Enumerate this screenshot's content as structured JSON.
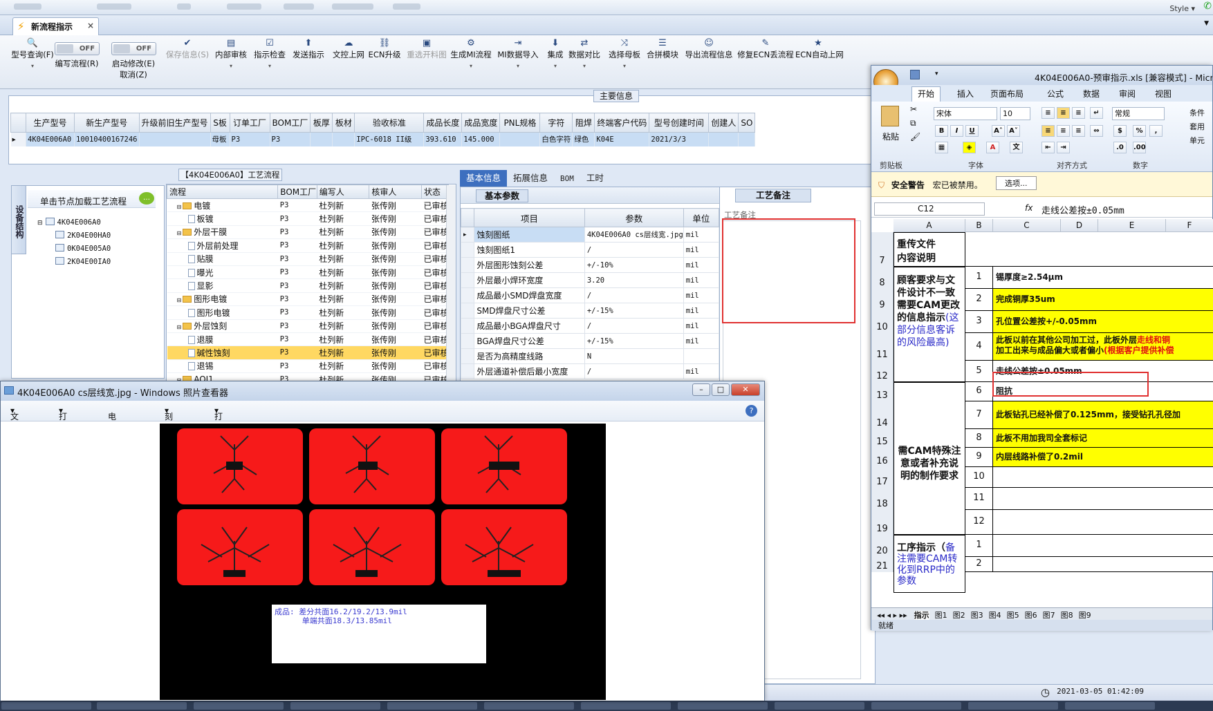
{
  "app": {
    "style_label": "Style ▾",
    "doc_tab": "新流程指示"
  },
  "toolbar": {
    "items": [
      {
        "label": "型号查询(F)",
        "icon": "search-icon",
        "disabled": false
      },
      {
        "label": "编写流程(R)",
        "icon": "toggle",
        "toggle": "OFF",
        "disabled": false
      },
      {
        "label": "启动修改(E)",
        "icon": "toggle",
        "toggle": "OFF",
        "disabled": false,
        "sub": "取消(Z)"
      },
      {
        "label": "保存信息(S)",
        "icon": "check-icon",
        "disabled": true
      },
      {
        "label": "内部审核",
        "icon": "audit-icon",
        "disabled": false
      },
      {
        "label": "指示检查",
        "icon": "checklist-icon",
        "disabled": false
      },
      {
        "label": "发送指示",
        "icon": "upload-icon",
        "disabled": false
      },
      {
        "label": "文控上网",
        "icon": "cloud-upload-icon",
        "disabled": false
      },
      {
        "label": "ECN升级",
        "icon": "binoculars-icon",
        "disabled": false
      },
      {
        "label": "重选开料图",
        "icon": "image-icon",
        "disabled": true
      },
      {
        "label": "生成MI流程",
        "icon": "gears-icon",
        "disabled": false
      },
      {
        "label": "MI数据导入",
        "icon": "import-icon",
        "disabled": false
      },
      {
        "label": "集成",
        "icon": "download-icon",
        "disabled": false
      },
      {
        "label": "数据对比",
        "icon": "compare-icon",
        "disabled": false
      },
      {
        "label": "选择母板",
        "icon": "shuffle-icon",
        "disabled": false
      },
      {
        "label": "合拼模块",
        "icon": "list-icon",
        "disabled": false
      },
      {
        "label": "导出流程信息",
        "icon": "smile-icon",
        "disabled": false
      },
      {
        "label": "修复ECN丢流程",
        "icon": "wrench-icon",
        "disabled": false
      },
      {
        "label": "ECN自动上网",
        "icon": "star-icon",
        "disabled": false
      }
    ]
  },
  "main_info": {
    "section_label": "主要信息",
    "headers": [
      "生产型号",
      "新生产型号",
      "升级前旧生产型号",
      "S板",
      "订单工厂",
      "BOM工厂",
      "板厚",
      "板材",
      "验收标准",
      "成品长度",
      "成品宽度",
      "PNL规格",
      "字符",
      "阻焊",
      "终端客户代码",
      "型号创建时间",
      "创建人",
      "SO"
    ],
    "row": [
      "4K04E006A0",
      "10010400167246",
      "",
      "母板",
      "P3",
      "P3",
      "",
      "",
      "IPC-6018 II级",
      "393.610",
      "145.000",
      "",
      "白色字符",
      "绿色",
      "K04E",
      "2021/3/3",
      "",
      ""
    ]
  },
  "left_panel": {
    "vertical_tab": "设备结构",
    "load_title": "单击节点加载工艺流程",
    "tree": [
      "4K04E006A0",
      "2K04E00HA0",
      "0K04E005A0",
      "2K04E00IA0"
    ]
  },
  "flow": {
    "label": "【4K04E006A0】工艺流程",
    "headers": [
      "流程",
      "BOM工厂",
      "编写人",
      "核审人",
      "状态"
    ],
    "rows": [
      {
        "name": "电镀",
        "level": 0,
        "folder": true,
        "bom": "P3",
        "writer": "杜列新",
        "reviewer": "张传刚",
        "status": "已审核"
      },
      {
        "name": "板镀",
        "level": 1,
        "folder": false,
        "bom": "P3",
        "writer": "杜列新",
        "reviewer": "张传刚",
        "status": "已审核"
      },
      {
        "name": "外层干膜",
        "level": 0,
        "folder": true,
        "bom": "P3",
        "writer": "杜列新",
        "reviewer": "张传刚",
        "status": "已审核"
      },
      {
        "name": "外层前处理",
        "level": 1,
        "folder": false,
        "bom": "P3",
        "writer": "杜列新",
        "reviewer": "张传刚",
        "status": "已审核"
      },
      {
        "name": "贴膜",
        "level": 1,
        "folder": false,
        "bom": "P3",
        "writer": "杜列新",
        "reviewer": "张传刚",
        "status": "已审核"
      },
      {
        "name": "曝光",
        "level": 1,
        "folder": false,
        "bom": "P3",
        "writer": "杜列新",
        "reviewer": "张传刚",
        "status": "已审核"
      },
      {
        "name": "显影",
        "level": 1,
        "folder": false,
        "bom": "P3",
        "writer": "杜列新",
        "reviewer": "张传刚",
        "status": "已审核"
      },
      {
        "name": "图形电镀",
        "level": 0,
        "folder": true,
        "bom": "P3",
        "writer": "杜列新",
        "reviewer": "张传刚",
        "status": "已审核"
      },
      {
        "name": "图形电镀",
        "level": 1,
        "folder": false,
        "bom": "P3",
        "writer": "杜列新",
        "reviewer": "张传刚",
        "status": "已审核"
      },
      {
        "name": "外层蚀刻",
        "level": 0,
        "folder": true,
        "bom": "P3",
        "writer": "杜列新",
        "reviewer": "张传刚",
        "status": "已审核"
      },
      {
        "name": "退膜",
        "level": 1,
        "folder": false,
        "bom": "P3",
        "writer": "杜列新",
        "reviewer": "张传刚",
        "status": "已审核"
      },
      {
        "name": "碱性蚀刻",
        "level": 1,
        "folder": false,
        "bom": "P3",
        "writer": "杜列新",
        "reviewer": "张传刚",
        "status": "已审核",
        "selected": true
      },
      {
        "name": "退锡",
        "level": 1,
        "folder": false,
        "bom": "P3",
        "writer": "杜列新",
        "reviewer": "张传刚",
        "status": "已审核"
      },
      {
        "name": "AOI1",
        "level": 0,
        "folder": true,
        "bom": "P3",
        "writer": "杜列新",
        "reviewer": "张传刚",
        "status": "已审核"
      }
    ]
  },
  "info_tabs": [
    "基本信息",
    "拓展信息",
    "BOM",
    "工时"
  ],
  "params": {
    "section": "基本参数",
    "headers": [
      "项目",
      "参数",
      "单位"
    ],
    "rows": [
      {
        "name": "蚀刻图纸",
        "value": "4K04E006A0 cs层线宽.jpg",
        "unit": "mil",
        "selected": true
      },
      {
        "name": "蚀刻图纸1",
        "value": "/",
        "unit": "mil"
      },
      {
        "name": "外层图形蚀刻公差",
        "value": "+/-10%",
        "unit": "mil"
      },
      {
        "name": "外层最小焊环宽度",
        "value": "3.20",
        "unit": "mil"
      },
      {
        "name": "成品最小SMD焊盘宽度",
        "value": "/",
        "unit": "mil"
      },
      {
        "name": "SMD焊盘尺寸公差",
        "value": "+/-15%",
        "unit": "mil"
      },
      {
        "name": "成品最小BGA焊盘尺寸",
        "value": "/",
        "unit": "mil"
      },
      {
        "name": "BGA焊盘尺寸公差",
        "value": "+/-15%",
        "unit": "mil"
      },
      {
        "name": "是否为高精度线路",
        "value": "N",
        "unit": ""
      },
      {
        "name": "外层通道补偿后最小宽度",
        "value": "/",
        "unit": "mil"
      }
    ]
  },
  "notes": {
    "header": "工艺备注",
    "sub": "工艺备注"
  },
  "status": {
    "clock": "2021-03-05 01:42:09"
  },
  "photo_viewer": {
    "title": "4K04E006A0 cs层线宽.jpg - Windows 照片查看器",
    "menus": [
      "文件(F)",
      "打印(P)",
      "电子邮件(E)",
      "刻录(U)",
      "打开(O)"
    ],
    "caption_line1": "成品: 差分共面16.2/19.2/13.9mil",
    "caption_line2": "单端共面18.3/13.85mil"
  },
  "excel": {
    "title": "4K04E006A0-预审指示.xls [兼容模式] - Micro",
    "ribbon_tabs": [
      "开始",
      "插入",
      "页面布局",
      "公式",
      "数据",
      "审阅",
      "视图"
    ],
    "paste_label": "粘贴",
    "font_name": "宋体",
    "font_size": "10",
    "number_format": "常规",
    "groups": [
      "剪贴板",
      "字体",
      "对齐方式",
      "数字"
    ],
    "side_labels": [
      "条件",
      "套用",
      "单元"
    ],
    "security_title": "安全警告",
    "security_text": "宏已被禁用。",
    "security_button": "选项...",
    "name_box": "C12",
    "formula": "走线公差按±0.05mm",
    "columns": [
      "A",
      "B",
      "C",
      "D",
      "E",
      "F"
    ],
    "row_numbers": [
      "7",
      "8",
      "9",
      "10",
      "11",
      "12",
      "13",
      "14",
      "15",
      "16",
      "17",
      "18",
      "19",
      "20",
      "21"
    ],
    "a7": "重传文件\n内容说明",
    "a8_12": "顾客要求与文件设计不一致需要CAM更改的信息指示",
    "a8_12_note": "(这部分信息客诉的风险最高)",
    "a13_19": "需CAM特殊注意或者补充说明的制作要求",
    "a20_21": "工序指示（",
    "a20_21_note": "备注需要CAM转化到RRP中的参数",
    "items": [
      {
        "n": "1",
        "text": "锡厚度≥2.54μm",
        "yellow": false
      },
      {
        "n": "2",
        "text": "完成铜厚35um",
        "yellow": true
      },
      {
        "n": "3",
        "text": "孔位置公差按+/-0.05mm",
        "yellow": true
      },
      {
        "n": "4",
        "text": "此板以前在其他公司加工过，此板外层",
        "text_red": "走线和铜",
        "text2": "加工出来与成品偏大或者偏小",
        "text2_red": "(根据客户提供补偿",
        "yellow": true
      },
      {
        "n": "5",
        "text": "走线公差按±0.05mm",
        "yellow": false
      },
      {
        "n": "6",
        "text": "阻抗",
        "yellow": false
      },
      {
        "n": "7",
        "text": "此板钻孔已经补偿了0.125mm，接受钻孔孔径加",
        "yellow": true
      },
      {
        "n": "8",
        "text": "此板不用加我司全套标记",
        "yellow": true
      },
      {
        "n": "9",
        "text": "内层线路补偿了0.2mil",
        "yellow": true
      },
      {
        "n": "10",
        "text": "",
        "yellow": false
      },
      {
        "n": "11",
        "text": "",
        "yellow": false
      },
      {
        "n": "12",
        "text": "",
        "yellow": false
      }
    ],
    "items2": [
      {
        "n": "1"
      },
      {
        "n": "2"
      }
    ],
    "sheets": [
      "指示",
      "图1",
      "图2",
      "图3",
      "图4",
      "图5",
      "图6",
      "图7",
      "图8",
      "图9"
    ],
    "status": "就绪"
  },
  "colors": {
    "accent": "#3d6fbf",
    "selection": "#ffd862",
    "highlight": "#ffff00",
    "pcb_red": "#f61a1a"
  }
}
